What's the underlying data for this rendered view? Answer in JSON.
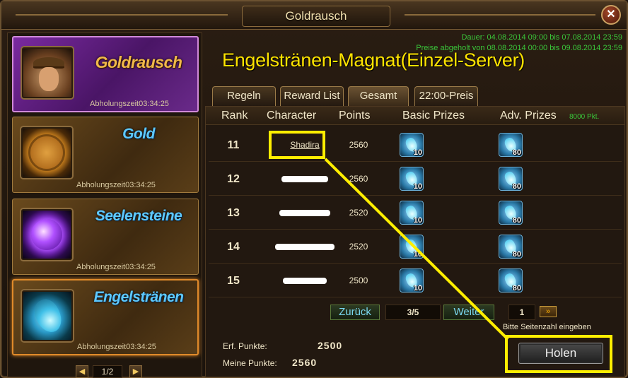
{
  "window": {
    "title": "Goldrausch",
    "close_label": "✕"
  },
  "sidebar": {
    "cards": [
      {
        "name": "Goldrausch",
        "time": "Abholungszeit03:34:25"
      },
      {
        "name": "Gold",
        "time": "Abholungszeit03:34:25"
      },
      {
        "name": "Seelensteine",
        "time": "Abholungszeit03:34:25"
      },
      {
        "name": "Engelstränen",
        "time": "Abholungszeit03:34:25"
      }
    ],
    "pager": {
      "prev": "◀",
      "text": "1/2",
      "next": "▶"
    }
  },
  "event": {
    "duration": "Dauer: 04.08.2014 09:00 bis 07.08.2014 23:59",
    "prizes_collected": "Preise abgeholt von 08.08.2014 00:00 bis 09.08.2014 23:59",
    "headline": "Engelstränen-Magnat(Einzel-Server)"
  },
  "tabs": [
    "Regeln",
    "Reward List",
    "Gesamt",
    "22:00-Preis"
  ],
  "table": {
    "headers": {
      "rank": "Rank",
      "character": "Character",
      "points": "Points",
      "basic": "Basic Prizes",
      "adv": "Adv. Prizes",
      "adv_note": "8000 Pkt."
    },
    "rows": [
      {
        "rank": "11",
        "character": "Shadira",
        "points": "2560",
        "basic_qty": "10",
        "adv_qty": "80"
      },
      {
        "rank": "12",
        "character": "",
        "points": "2560",
        "basic_qty": "10",
        "adv_qty": "80"
      },
      {
        "rank": "13",
        "character": "",
        "points": "2520",
        "basic_qty": "10",
        "adv_qty": "80"
      },
      {
        "rank": "14",
        "character": "",
        "points": "2520",
        "basic_qty": "10",
        "adv_qty": "80"
      },
      {
        "rank": "15",
        "character": "",
        "points": "2500",
        "basic_qty": "10",
        "adv_qty": "80"
      }
    ]
  },
  "pagination": {
    "back": "Zurück",
    "page": "3/5",
    "next": "Weiter",
    "input_value": "1",
    "go": "»",
    "hint": "Bitte Seitenzahl eingeben"
  },
  "stats": {
    "required_label": "Erf. Punkte:",
    "required_value": "2500",
    "mine_label": "Meine Punkte:",
    "mine_value": "2560"
  },
  "claim_button": "Holen",
  "colors": {
    "headline": "#ffe400",
    "dates": "#3ac63a",
    "highlight": "#ffee00",
    "active_card": "#7a2aa0"
  }
}
